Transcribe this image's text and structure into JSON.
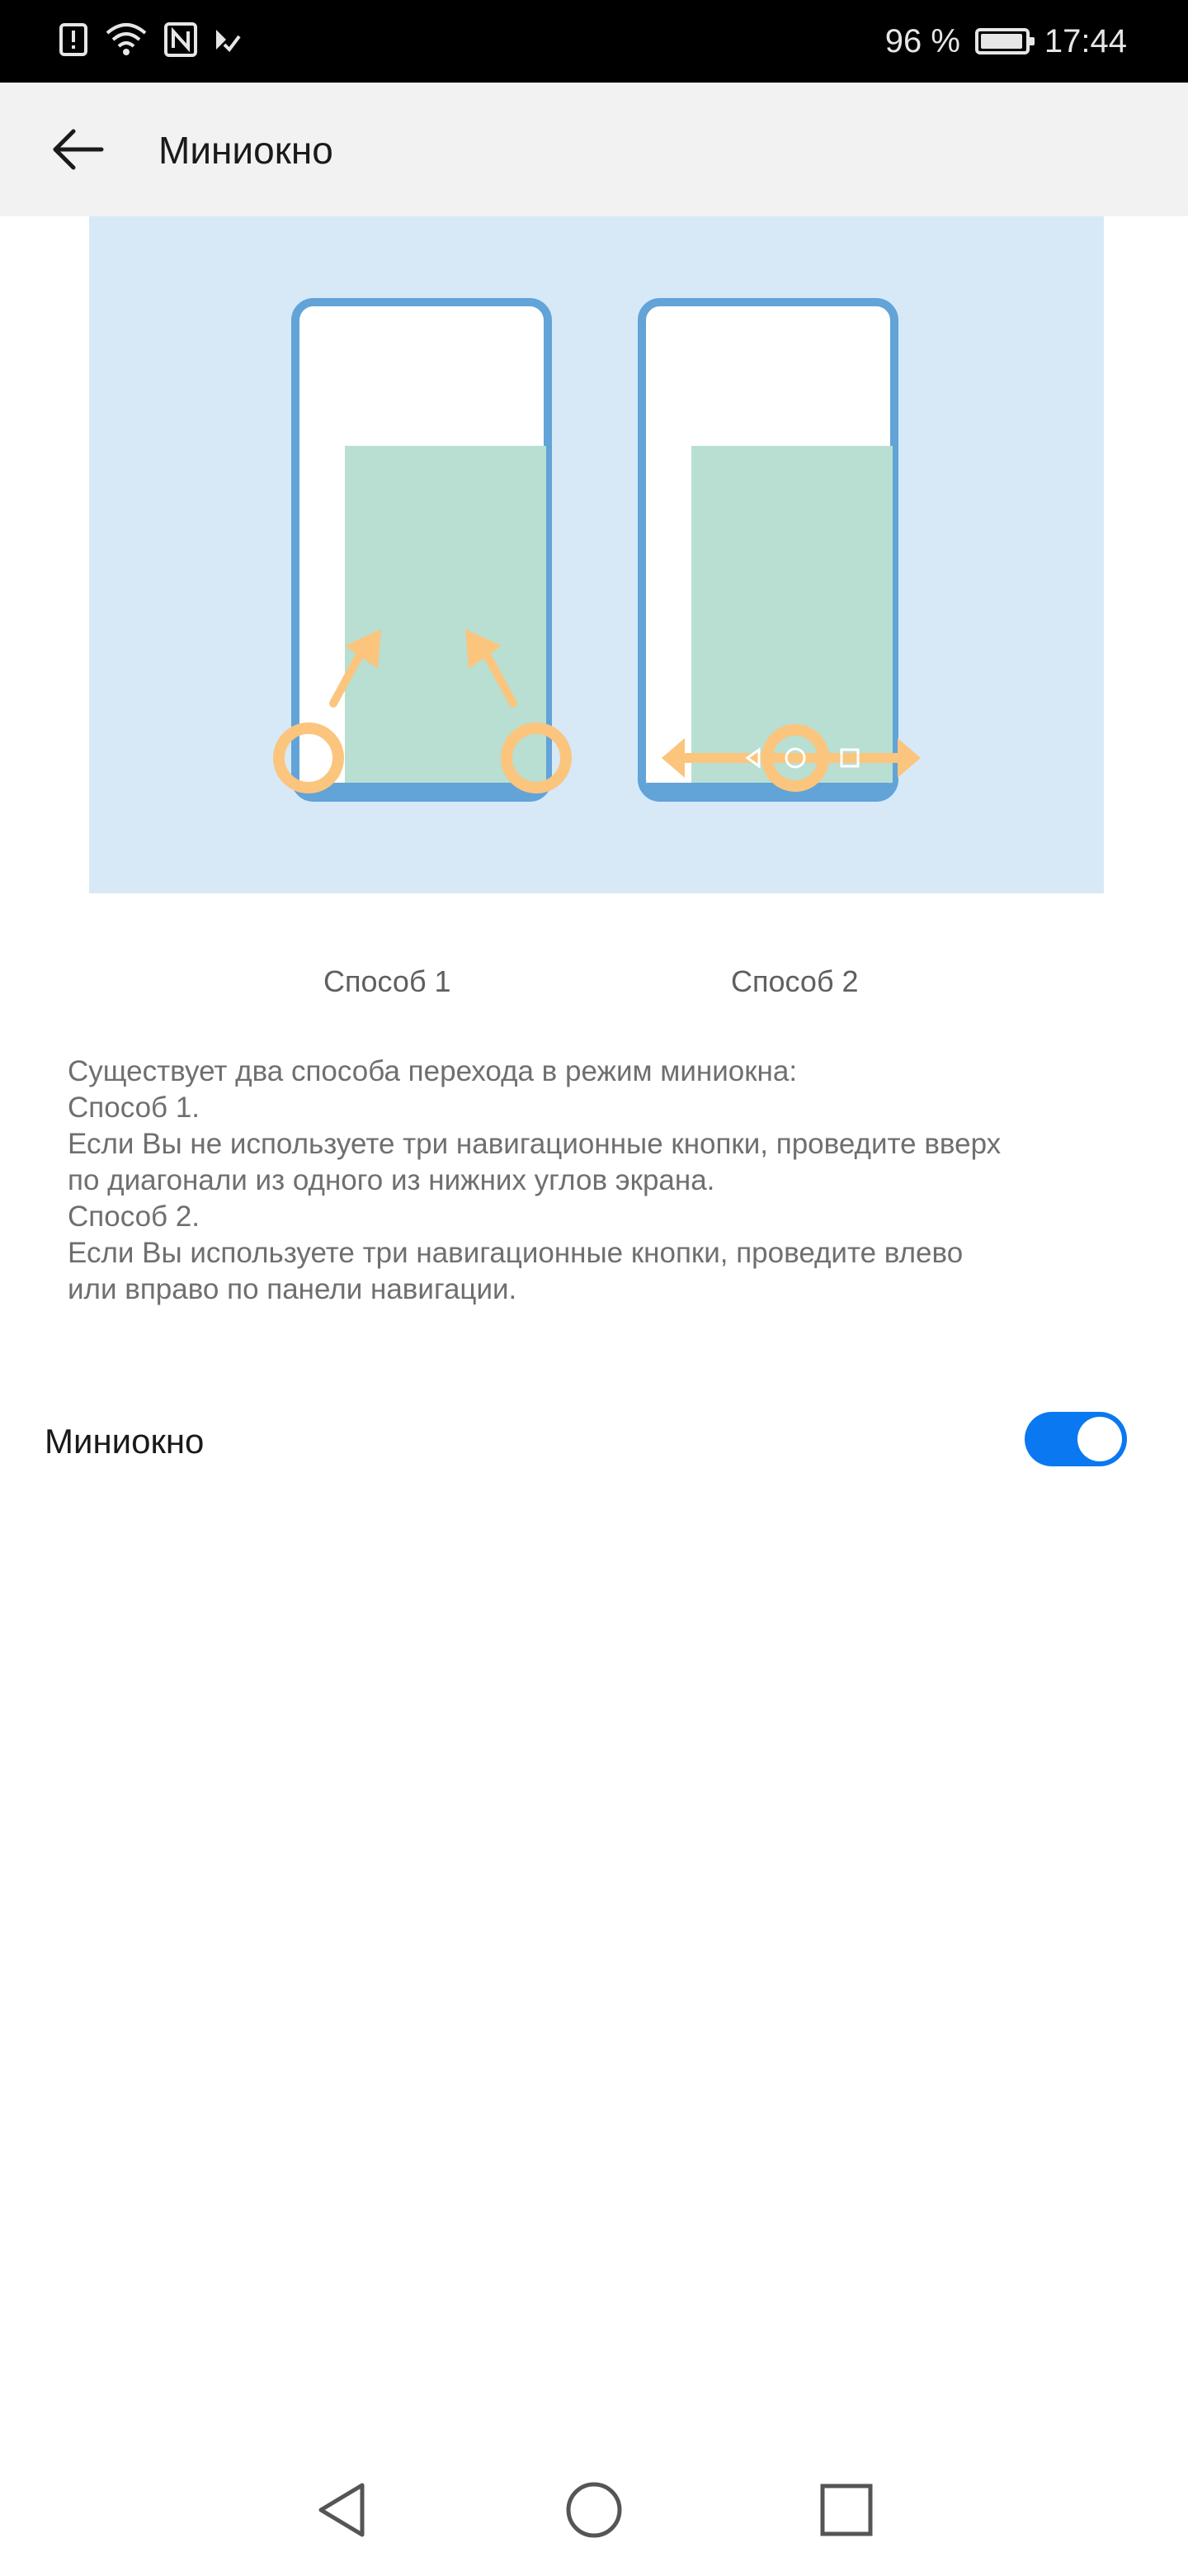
{
  "status_bar": {
    "icons": [
      "alert-icon",
      "wifi-icon",
      "nfc-icon",
      "check-notification-icon"
    ],
    "battery_percent_label": "96 %",
    "battery_level": 0.96,
    "time": "17:44"
  },
  "header": {
    "title": "Миниокно",
    "back_icon": "arrow-left-icon"
  },
  "illustration": {
    "colors": {
      "background": "#d7e9f7",
      "phone_frame": "#62a3d8",
      "window": "#b8dfd2",
      "gesture": "#fbc57e"
    },
    "captions": {
      "method1": "Способ 1",
      "method2": "Способ 2"
    }
  },
  "description": {
    "lines": [
      "Существует два способа перехода в режим миниокна:",
      "Способ 1.",
      "Если Вы не используете три навигационные кнопки, проведите вверх",
      "по диагонали из одного из нижних углов экрана.",
      "Способ 2.",
      "Если Вы используете три навигационные кнопки, проведите влево",
      "или вправо по панели навигации."
    ]
  },
  "setting": {
    "label": "Миниокно",
    "enabled": true,
    "accent_color": "#0a78f0"
  },
  "nav_bar": {
    "buttons": [
      "back-triangle-icon",
      "home-circle-icon",
      "recents-square-icon"
    ]
  }
}
